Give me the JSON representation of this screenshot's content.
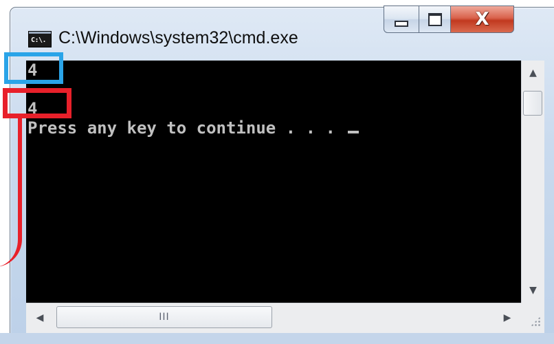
{
  "window": {
    "title": "C:\\Windows\\system32\\cmd.exe",
    "icon_label": "C:\\.",
    "icon_name": "console-app-icon",
    "controls": {
      "minimize_icon": "minimize-icon",
      "maximize_icon": "maximize-icon",
      "close_icon": "close-icon",
      "close_glyph": "X"
    }
  },
  "console": {
    "background_color": "#000000",
    "text_color": "#c0c0c0",
    "lines": [
      "4",
      "4",
      "Press any key to continue . . . "
    ]
  },
  "scrollbars": {
    "vertical": {
      "up_arrow": "▲",
      "down_arrow": "▼"
    },
    "horizontal": {
      "left_arrow": "◀",
      "right_arrow": "▶",
      "grip": "III"
    }
  },
  "annotations": {
    "blue_box_color": "#2aa4e8",
    "red_box_color": "#e8202a"
  }
}
